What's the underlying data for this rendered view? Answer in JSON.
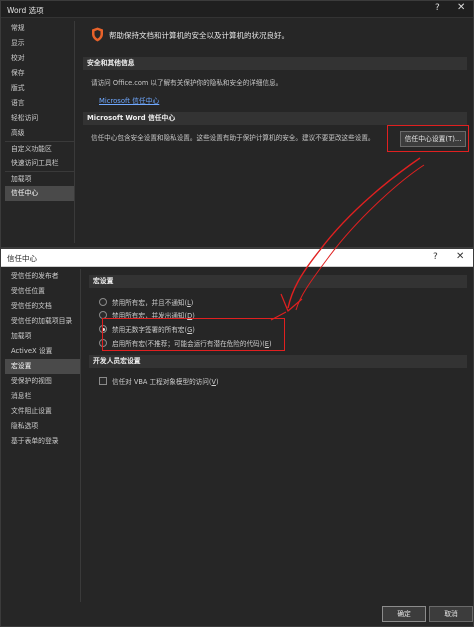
{
  "word_options": {
    "title": "Word 选项",
    "help": "?",
    "close": "✕",
    "sidebar": [
      {
        "label": "常规"
      },
      {
        "label": "显示"
      },
      {
        "label": "校对"
      },
      {
        "label": "保存"
      },
      {
        "label": "版式"
      },
      {
        "label": "语言"
      },
      {
        "label": "轻松访问"
      },
      {
        "label": "高级"
      },
      {
        "label": "自定义功能区"
      },
      {
        "label": "快速访问工具栏"
      },
      {
        "label": "加载项"
      },
      {
        "label": "信任中心"
      }
    ],
    "selected_item": "信任中心",
    "banner_text": "帮助保持文档和计算机的安全以及计算机的状况良好。",
    "privacy_section_title": "安全和其他信息",
    "privacy_text": "请访问 Office.com 以了解有关保护你的隐私和安全的详细信息。",
    "privacy_link": "Microsoft 信任中心",
    "trust_section_title": "Microsoft Word 信任中心",
    "trust_text": "信任中心包含安全设置和隐私设置。这些设置有助于保护计算机的安全。建议不要更改这些设置。",
    "trust_button": "信任中心设置(T)..."
  },
  "trust_center": {
    "title": "信任中心",
    "help": "?",
    "close": "✕",
    "sidebar": [
      {
        "label": "受信任的发布者"
      },
      {
        "label": "受信任位置"
      },
      {
        "label": "受信任的文档"
      },
      {
        "label": "受信任的加载项目录"
      },
      {
        "label": "加载项"
      },
      {
        "label": "ActiveX 设置"
      },
      {
        "label": "宏设置"
      },
      {
        "label": "受保护的视图"
      },
      {
        "label": "消息栏"
      },
      {
        "label": "文件阻止设置"
      },
      {
        "label": "隐私选项"
      },
      {
        "label": "基于表单的登录"
      }
    ],
    "selected_item": "宏设置",
    "macro_section_title": "宏设置",
    "macro_options": [
      {
        "label": "禁用所有宏，并且不通知(",
        "key": "L",
        "suffix": ")",
        "checked": false
      },
      {
        "label": "禁用所有宏，并发出通知(",
        "key": "D",
        "suffix": ")",
        "checked": false
      },
      {
        "label": "禁用无数字签署的所有宏(",
        "key": "G",
        "suffix": ")",
        "checked": true
      },
      {
        "label": "启用所有宏(不推荐；可能会运行有潜在危险的代码)(",
        "key": "E",
        "suffix": ")",
        "checked": false
      }
    ],
    "dev_section_title": "开发人员宏设置",
    "vba_checkbox": {
      "label": "信任对 VBA 工程对象模型的访问(",
      "key": "V",
      "suffix": ")",
      "checked": false
    },
    "ok_button": "确定",
    "cancel_button": "取消"
  },
  "colors": {
    "annotation_red": "#e02020",
    "link_blue": "#6fa8ff",
    "shield_orange": "#e8622a"
  }
}
